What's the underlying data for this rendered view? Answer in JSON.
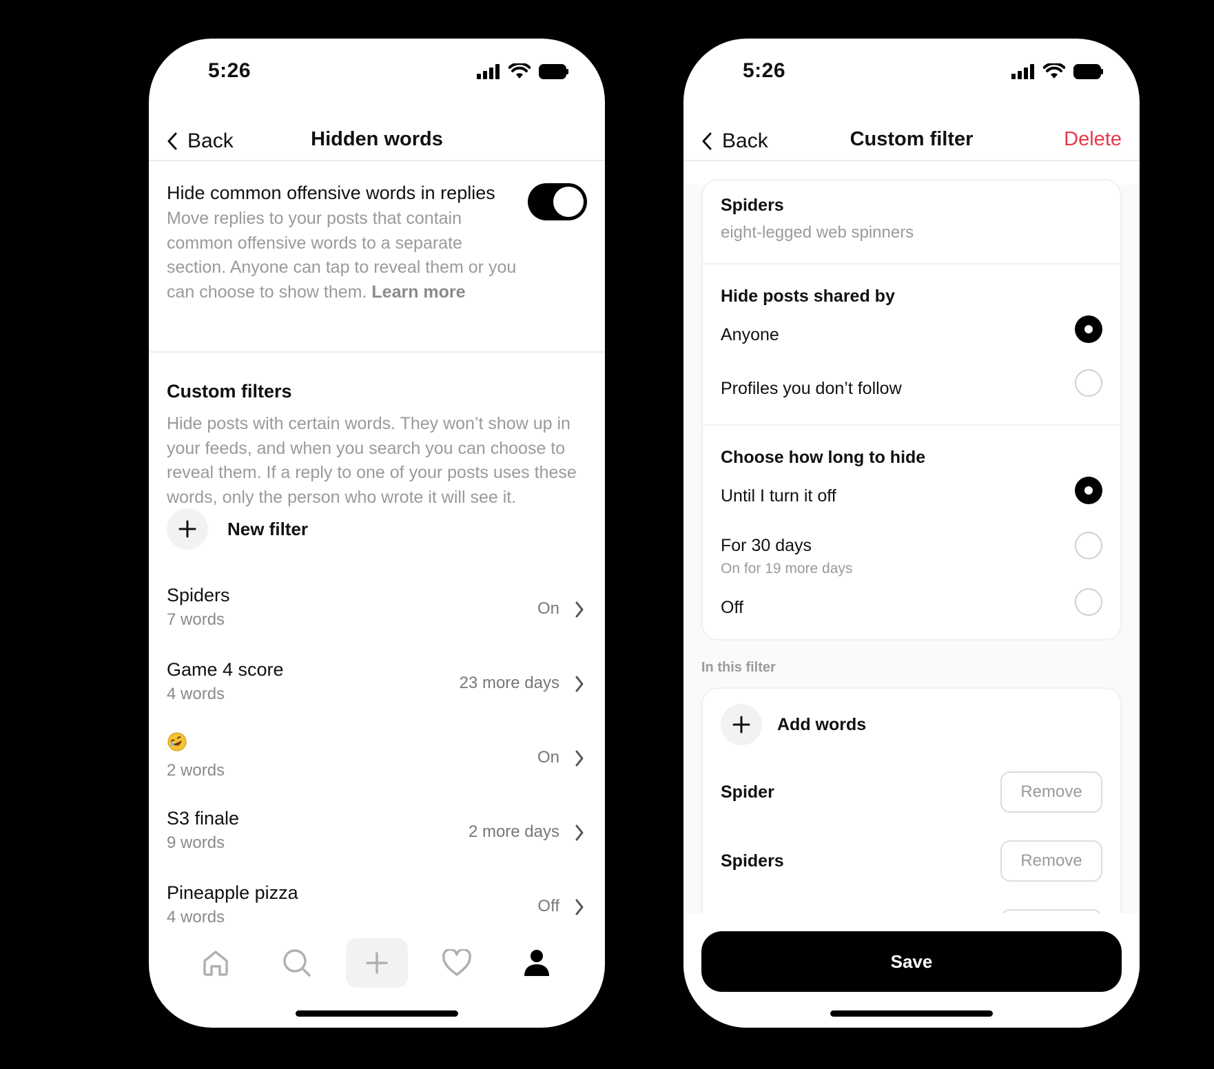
{
  "left": {
    "status": {
      "time": "5:26"
    },
    "header": {
      "back_label": "Back",
      "title": "Hidden words"
    },
    "toggle": {
      "title": "Hide common offensive words in replies",
      "description": "Move replies to your posts that contain common offensive words to a separate section. Anyone can tap to reveal them or you can choose to show them.",
      "learn_more": "Learn more",
      "enabled": true
    },
    "custom_filters": {
      "heading": "Custom filters",
      "description": "Hide posts with certain words. They won’t show up in your feeds, and when you search you can choose to reveal them. If a reply to one of your posts uses these words, only the person who wrote it will see it.",
      "new_filter_label": "New filter",
      "items": [
        {
          "name": "Spiders",
          "count": "7 words",
          "status": "On"
        },
        {
          "name": "Game 4 score",
          "count": "4 words",
          "status": "23 more days"
        },
        {
          "name": "",
          "icon": "rolling-on-floor-laughing-emoji",
          "count": "2 words",
          "status": "On"
        },
        {
          "name": "S3 finale",
          "count": "9 words",
          "status": "2 more days"
        },
        {
          "name": "Pineapple pizza",
          "count": "4 words",
          "status": "Off"
        }
      ]
    },
    "tabbar": [
      "home-icon",
      "search-icon",
      "plus-icon",
      "heart-icon",
      "profile-icon"
    ]
  },
  "right": {
    "status": {
      "time": "5:26"
    },
    "header": {
      "back_label": "Back",
      "title": "Custom filter",
      "delete_label": "Delete"
    },
    "filter": {
      "name": "Spiders",
      "description": "eight-legged web spinners"
    },
    "shared_by": {
      "heading": "Hide posts shared by",
      "options": [
        {
          "label": "Anyone",
          "selected": true
        },
        {
          "label": "Profiles you don’t follow",
          "selected": false
        }
      ]
    },
    "duration": {
      "heading": "Choose how long to hide",
      "options": [
        {
          "label": "Until I turn it off",
          "selected": true
        },
        {
          "label": "For 30 days",
          "sublabel": "On for 19 more days",
          "selected": false
        },
        {
          "label": "Off",
          "selected": false
        }
      ]
    },
    "words": {
      "section_label": "In this filter",
      "add_label": "Add words",
      "remove_label": "Remove",
      "items": [
        "Spider",
        "Spiders"
      ]
    },
    "save_label": "Save"
  },
  "colors": {
    "accent_delete": "#e5394b",
    "primary": "#000000",
    "muted_text": "#9a9a9a"
  }
}
